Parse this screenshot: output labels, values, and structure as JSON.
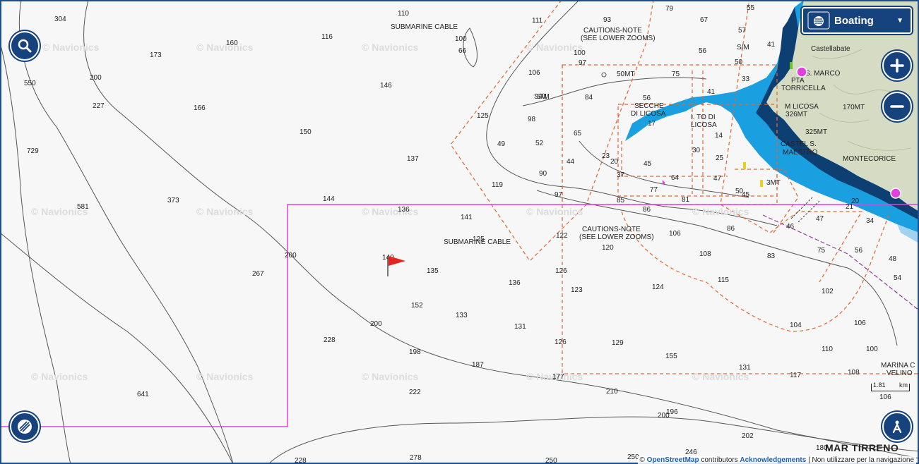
{
  "controls": {
    "chart_mode_label": "Boating"
  },
  "map_labels": {
    "submarine_cable_top": "SUBMARINE CABLE",
    "submarine_cable_mid": "SUBMARINE CABLE",
    "cautions_top_1": "CAUTIONS-NOTE",
    "cautions_top_2": "(SEE LOWER ZOOMS)",
    "cautions_mid_1": "CAUTIONS-NOTE",
    "cautions_mid_2": "(SEE LOWER ZOOMS)",
    "secche_1": "SECCHE",
    "secche_2": "DI LICOSA",
    "isolotto_1": "I. TO DI",
    "isolotto_2": "LICOSA",
    "pta_1": "PTA",
    "pta_2": "TORRICELLA",
    "s_marco": "S. MARCO",
    "m_licosa_1": "M LICOSA",
    "m_licosa_2": "326MT",
    "h_325": "325MT",
    "h_170": "170MT",
    "castelsabato": "CASTEL S.",
    "maestro": "MAESTRO",
    "montecorice": "MONTECORICE",
    "castellabate": "Castellabate",
    "marina_1": "MARINA C",
    "marina_2": "VELINO",
    "sm_1": "S/M",
    "sm_2": "S/M",
    "mt_3": "3MT",
    "m50": "50MT",
    "sea_name": "MAR TIRRENO"
  },
  "watermark": "© Navionics",
  "depths": [
    "304",
    "110",
    "111",
    "93",
    "79",
    "55",
    "67",
    "57",
    "41",
    "160",
    "116",
    "100",
    "66",
    "173",
    "200",
    "550",
    "227",
    "166",
    "146",
    "106",
    "97",
    "100",
    "56",
    "50",
    "75",
    "41",
    "33",
    "84",
    "56",
    "S/M",
    "125",
    "98",
    "52",
    "49",
    "65",
    "17",
    "14",
    "150",
    "137",
    "44",
    "23",
    "20",
    "37",
    "45",
    "64",
    "47",
    "25",
    "30",
    "119",
    "90",
    "97",
    "85",
    "86",
    "81",
    "77",
    "50",
    "45",
    "46",
    "47",
    "21",
    "20",
    "34",
    "729",
    "581",
    "373",
    "144",
    "136",
    "141",
    "125",
    "122",
    "106",
    "86",
    "83",
    "75",
    "56",
    "48",
    "54",
    "200",
    "267",
    "140",
    "135",
    "126",
    "136",
    "108",
    "124",
    "115",
    "102",
    "123",
    "152",
    "133",
    "131",
    "120",
    "200",
    "228",
    "198",
    "126",
    "129",
    "155",
    "104",
    "106",
    "110",
    "100",
    "187",
    "177",
    "131",
    "117",
    "108",
    "641",
    "222",
    "210",
    "196",
    "200",
    "202",
    "228",
    "278",
    "250",
    "250",
    "246",
    "180",
    "106"
  ],
  "scale": {
    "value": "1.81",
    "unit": "km"
  },
  "attribution": {
    "prefix": "©",
    "osm": "OpenStreetMap",
    "contrib": "contributors",
    "ack": "Acknowledgements",
    "notice": "| Non utilizzare per la navigazione"
  },
  "colors": {
    "boundary": "#e040e0",
    "dashed_zone": "#e8642e",
    "shallow_water": "#1a9fe0",
    "very_shallow": "#0d3f73",
    "land": "#d6dcc4",
    "button": "#16427d"
  }
}
